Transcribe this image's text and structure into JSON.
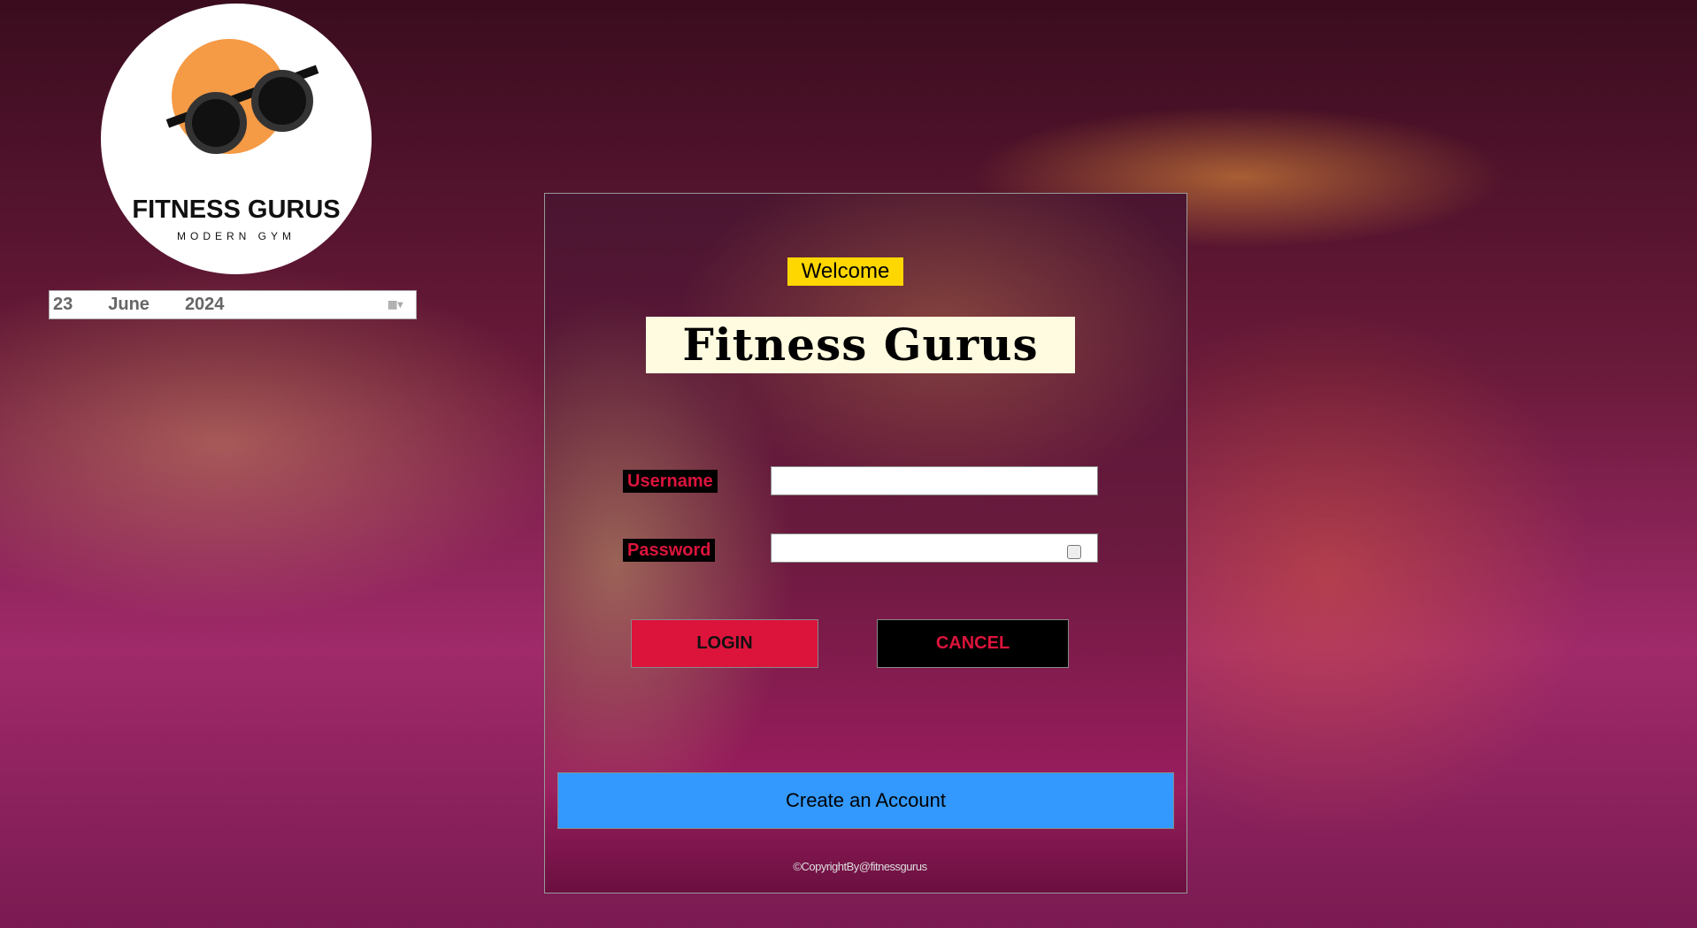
{
  "logo": {
    "name": "FITNESS GURUS",
    "tagline": "MODERN GYM"
  },
  "date_picker": {
    "day": "23",
    "month": "June",
    "year": "2024",
    "icon": "calendar-icon"
  },
  "login": {
    "welcome": "Welcome",
    "title": "Fitness Gurus",
    "username_label": "Username",
    "username_value": "",
    "password_label": "Password",
    "password_value": "",
    "login_button": "LOGIN",
    "cancel_button": "CANCEL",
    "create_account_button": "Create an Account",
    "copyright": "©CopyrightBy@fitnessgurus"
  },
  "colors": {
    "accent": "#dc143c",
    "create": "#3399ff",
    "welcome": "#ffd700"
  }
}
